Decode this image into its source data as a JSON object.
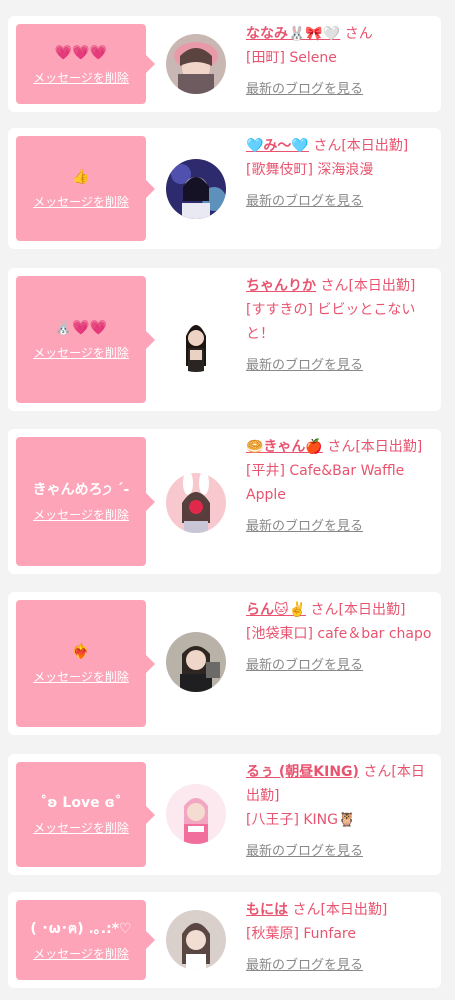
{
  "accent_color": "#e8546f",
  "bubble_color": "#fda4b8",
  "cards": [
    {
      "message": "💗💗💗",
      "delete_label": "メッセージを削除",
      "name": "ななみ🐰🎀🤍",
      "suffix": "さん",
      "shop": "[田町] Selene",
      "blog_label": "最新のブログを見る"
    },
    {
      "message": "👍",
      "delete_label": "メッセージを削除",
      "name": "🩵み〜🩵",
      "suffix": "さん[本日出勤]",
      "shop": "[歌舞伎町] 深海浪漫",
      "blog_label": "最新のブログを見る"
    },
    {
      "message": "🐰💗💗",
      "delete_label": "メッセージを削除",
      "name": "ちゃんりか",
      "suffix": "さん[本日出勤]",
      "shop": "[すすきの] ビビッとこないと！",
      "blog_label": "最新のブログを見る"
    },
    {
      "message": "きゃんめろ੭ ˊ-",
      "delete_label": "メッセージを削除",
      "name": "🥯きゃん🍎",
      "suffix": "さん[本日出勤]",
      "shop": "[平井] Cafe&Bar Waffle Apple",
      "blog_label": "最新のブログを見る"
    },
    {
      "message": "❤️‍🔥",
      "delete_label": "メッセージを削除",
      "name": "らん🐱✌️",
      "suffix": "さん[本日出勤]",
      "shop": "[池袋東口] cafe＆bar chapo",
      "blog_label": "最新のブログを見る"
    },
    {
      "message": "˚ʚ Love ɞ˚",
      "delete_label": "メッセージを削除",
      "name": "るぅ (朝昼KING)",
      "suffix": "さん[本日出勤]",
      "shop": "[八王子] KING🦉",
      "blog_label": "最新のブログを見る"
    },
    {
      "message": "( ･ω･ฅ) .｡.:*♡",
      "delete_label": "メッセージを削除",
      "name": "もには",
      "suffix": "さん[本日出勤]",
      "shop": "[秋葉原] Funfare",
      "blog_label": "最新のブログを見る"
    }
  ]
}
